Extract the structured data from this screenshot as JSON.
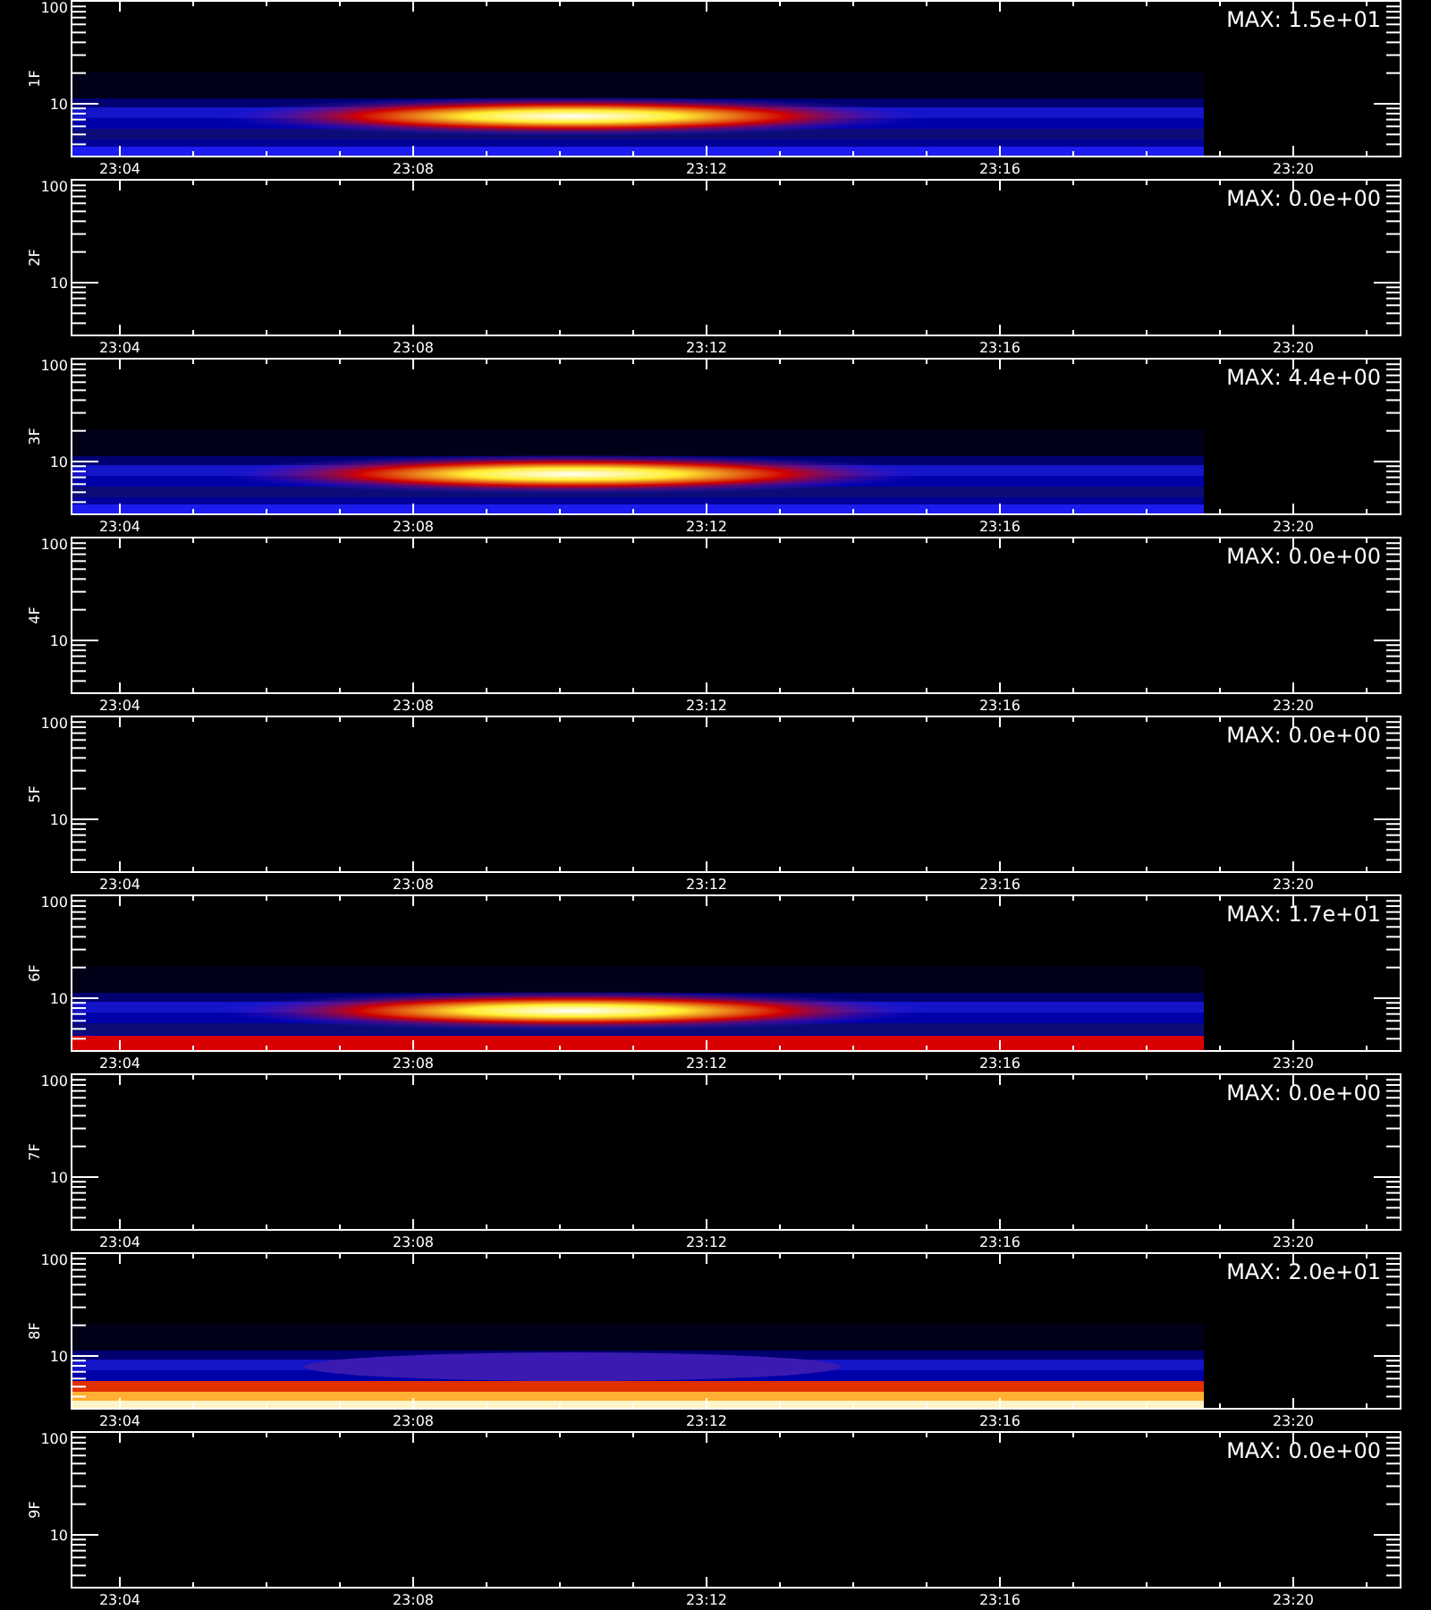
{
  "panels": [
    {
      "label": "1F",
      "max": "MAX: 1.5e+01",
      "kind": "burst",
      "yticks": [
        "100",
        "10"
      ],
      "xticks": [
        "23:04",
        "23:08",
        "23:12",
        "23:16",
        "23:20"
      ]
    },
    {
      "label": "2F",
      "max": "MAX: 0.0e+00",
      "kind": "none",
      "yticks": [
        "100",
        "10"
      ],
      "xticks": [
        "23:04",
        "23:08",
        "23:12",
        "23:16",
        "23:20"
      ]
    },
    {
      "label": "3F",
      "max": "MAX: 4.4e+00",
      "kind": "burst",
      "yticks": [
        "100",
        "10"
      ],
      "xticks": [
        "23:04",
        "23:08",
        "23:12",
        "23:16",
        "23:20"
      ]
    },
    {
      "label": "4F",
      "max": "MAX: 0.0e+00",
      "kind": "none",
      "yticks": [
        "100",
        "10"
      ],
      "xticks": [
        "23:04",
        "23:08",
        "23:12",
        "23:16",
        "23:20"
      ]
    },
    {
      "label": "5F",
      "max": "MAX: 0.0e+00",
      "kind": "none",
      "yticks": [
        "100",
        "10"
      ],
      "xticks": [
        "23:04",
        "23:08",
        "23:12",
        "23:16",
        "23:20"
      ]
    },
    {
      "label": "6F",
      "max": "MAX: 1.7e+01",
      "kind": "burst-red-floor",
      "yticks": [
        "100",
        "10"
      ],
      "xticks": [
        "23:04",
        "23:08",
        "23:12",
        "23:16",
        "23:20"
      ]
    },
    {
      "label": "7F",
      "max": "MAX: 0.0e+00",
      "kind": "none",
      "yticks": [
        "100",
        "10"
      ],
      "xticks": [
        "23:04",
        "23:08",
        "23:12",
        "23:16",
        "23:20"
      ]
    },
    {
      "label": "8F",
      "max": "MAX: 2.0e+01",
      "kind": "faint-burst-hot-floor",
      "yticks": [
        "100",
        "10"
      ],
      "xticks": [
        "23:04",
        "23:08",
        "23:12",
        "23:16",
        "23:20"
      ]
    },
    {
      "label": "9F",
      "max": "MAX: 0.0e+00",
      "kind": "none",
      "yticks": [
        "100",
        "10"
      ],
      "xticks": [
        "23:04",
        "23:08",
        "23:12",
        "23:16",
        "23:20"
      ]
    }
  ]
}
